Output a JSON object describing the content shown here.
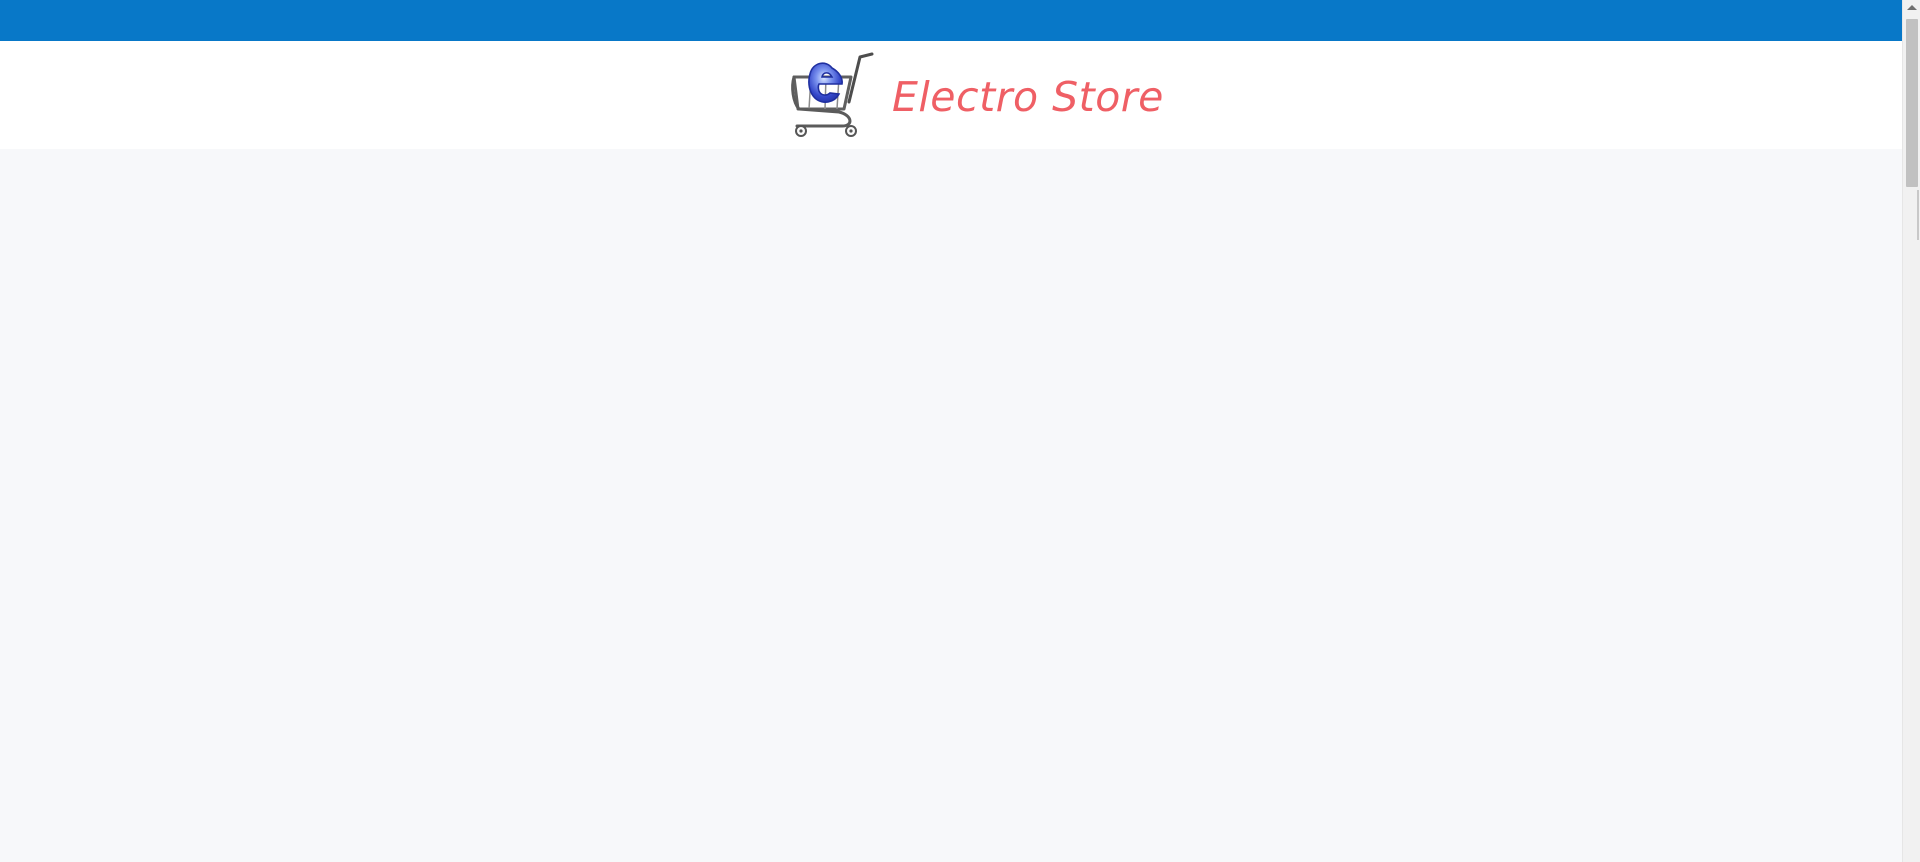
{
  "header": {
    "store_name": "Electro Store",
    "logo_icon": "shopping-cart-with-e-icon"
  },
  "colors": {
    "top_bar": "#0878c8",
    "brand_text": "#ef5f65",
    "header_bg": "#ffffff",
    "page_bg": "#f7f8fa"
  }
}
